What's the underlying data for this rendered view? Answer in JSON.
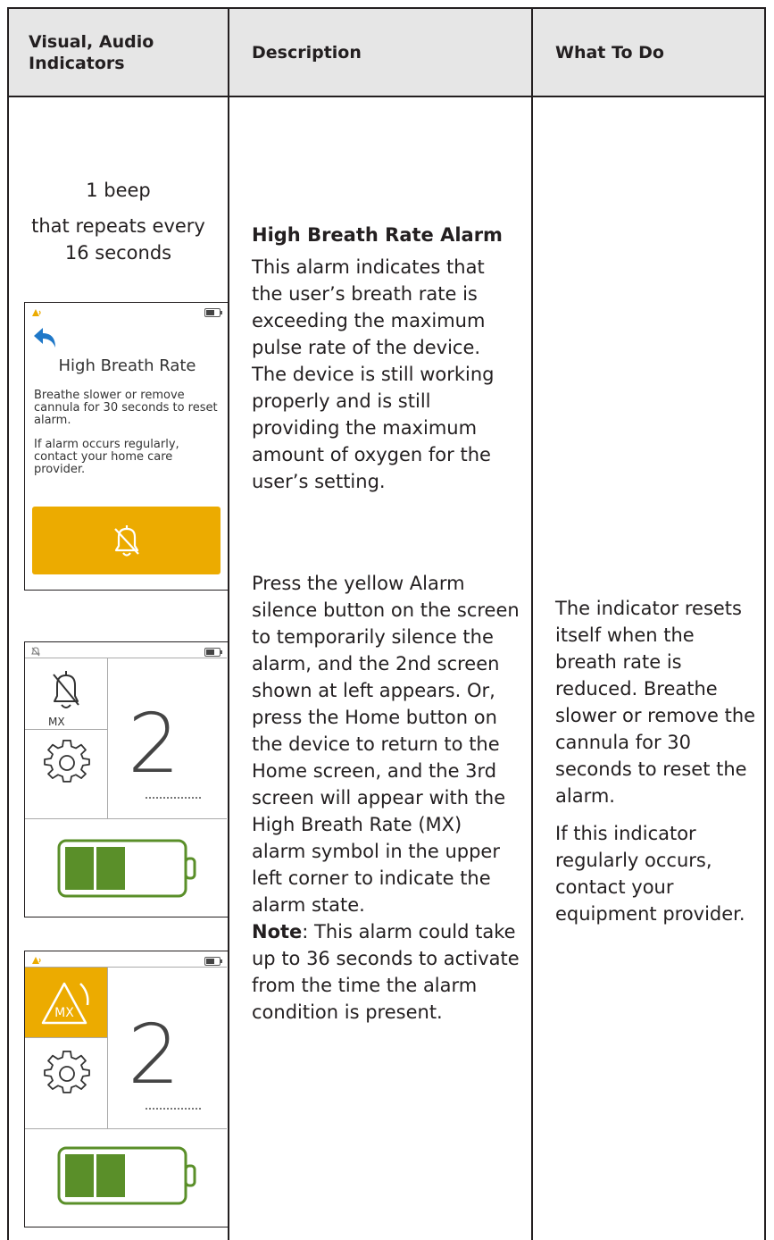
{
  "header": {
    "col1": "Visual, Audio Indicators",
    "col2": "Description",
    "col3": "What To Do"
  },
  "indicators": {
    "beep": "1 beep",
    "repeat": "that repeats every\n16 seconds"
  },
  "screen1": {
    "title": "High Breath Rate",
    "message1": "Breathe slower or remove cannula for 30 seconds to reset alarm.",
    "message2": "If alarm occurs regularly, contact your home care provider.",
    "accent_color": "#ecab00",
    "back_icon_color": "#1f78c8"
  },
  "screen2": {
    "mx_label": "MX",
    "setting": "2",
    "battery_color": "#5a8f29"
  },
  "screen3": {
    "mx_label": "MX",
    "setting": "2",
    "battery_color": "#5a8f29"
  },
  "description": {
    "title": "High Breath Rate Alarm",
    "p1": "This alarm indicates that the user’s breath rate is exceeding the maximum pulse rate of the device. The device is still working properly and is still providing the maximum amount of oxygen for the user’s setting.",
    "p2": "Press the yellow Alarm silence button on the screen to temporarily silence the alarm, and the 2nd screen shown at left appears. Or, press the Home button on the device to return to the Home screen, and the 3rd screen will appear with the High Breath Rate (MX) alarm symbol in the upper left corner to indicate the alarm state.",
    "note_label": "Note",
    "note_text": ": This alarm could take up to 36 seconds to activate from the time the alarm condition is present."
  },
  "what_to_do": {
    "p1": "The indicator resets itself when the breath rate is reduced. Breathe slower or remove the cannula for 30 seconds to reset the alarm.",
    "p2": "If this indicator regularly occurs, contact your equipment provider."
  }
}
